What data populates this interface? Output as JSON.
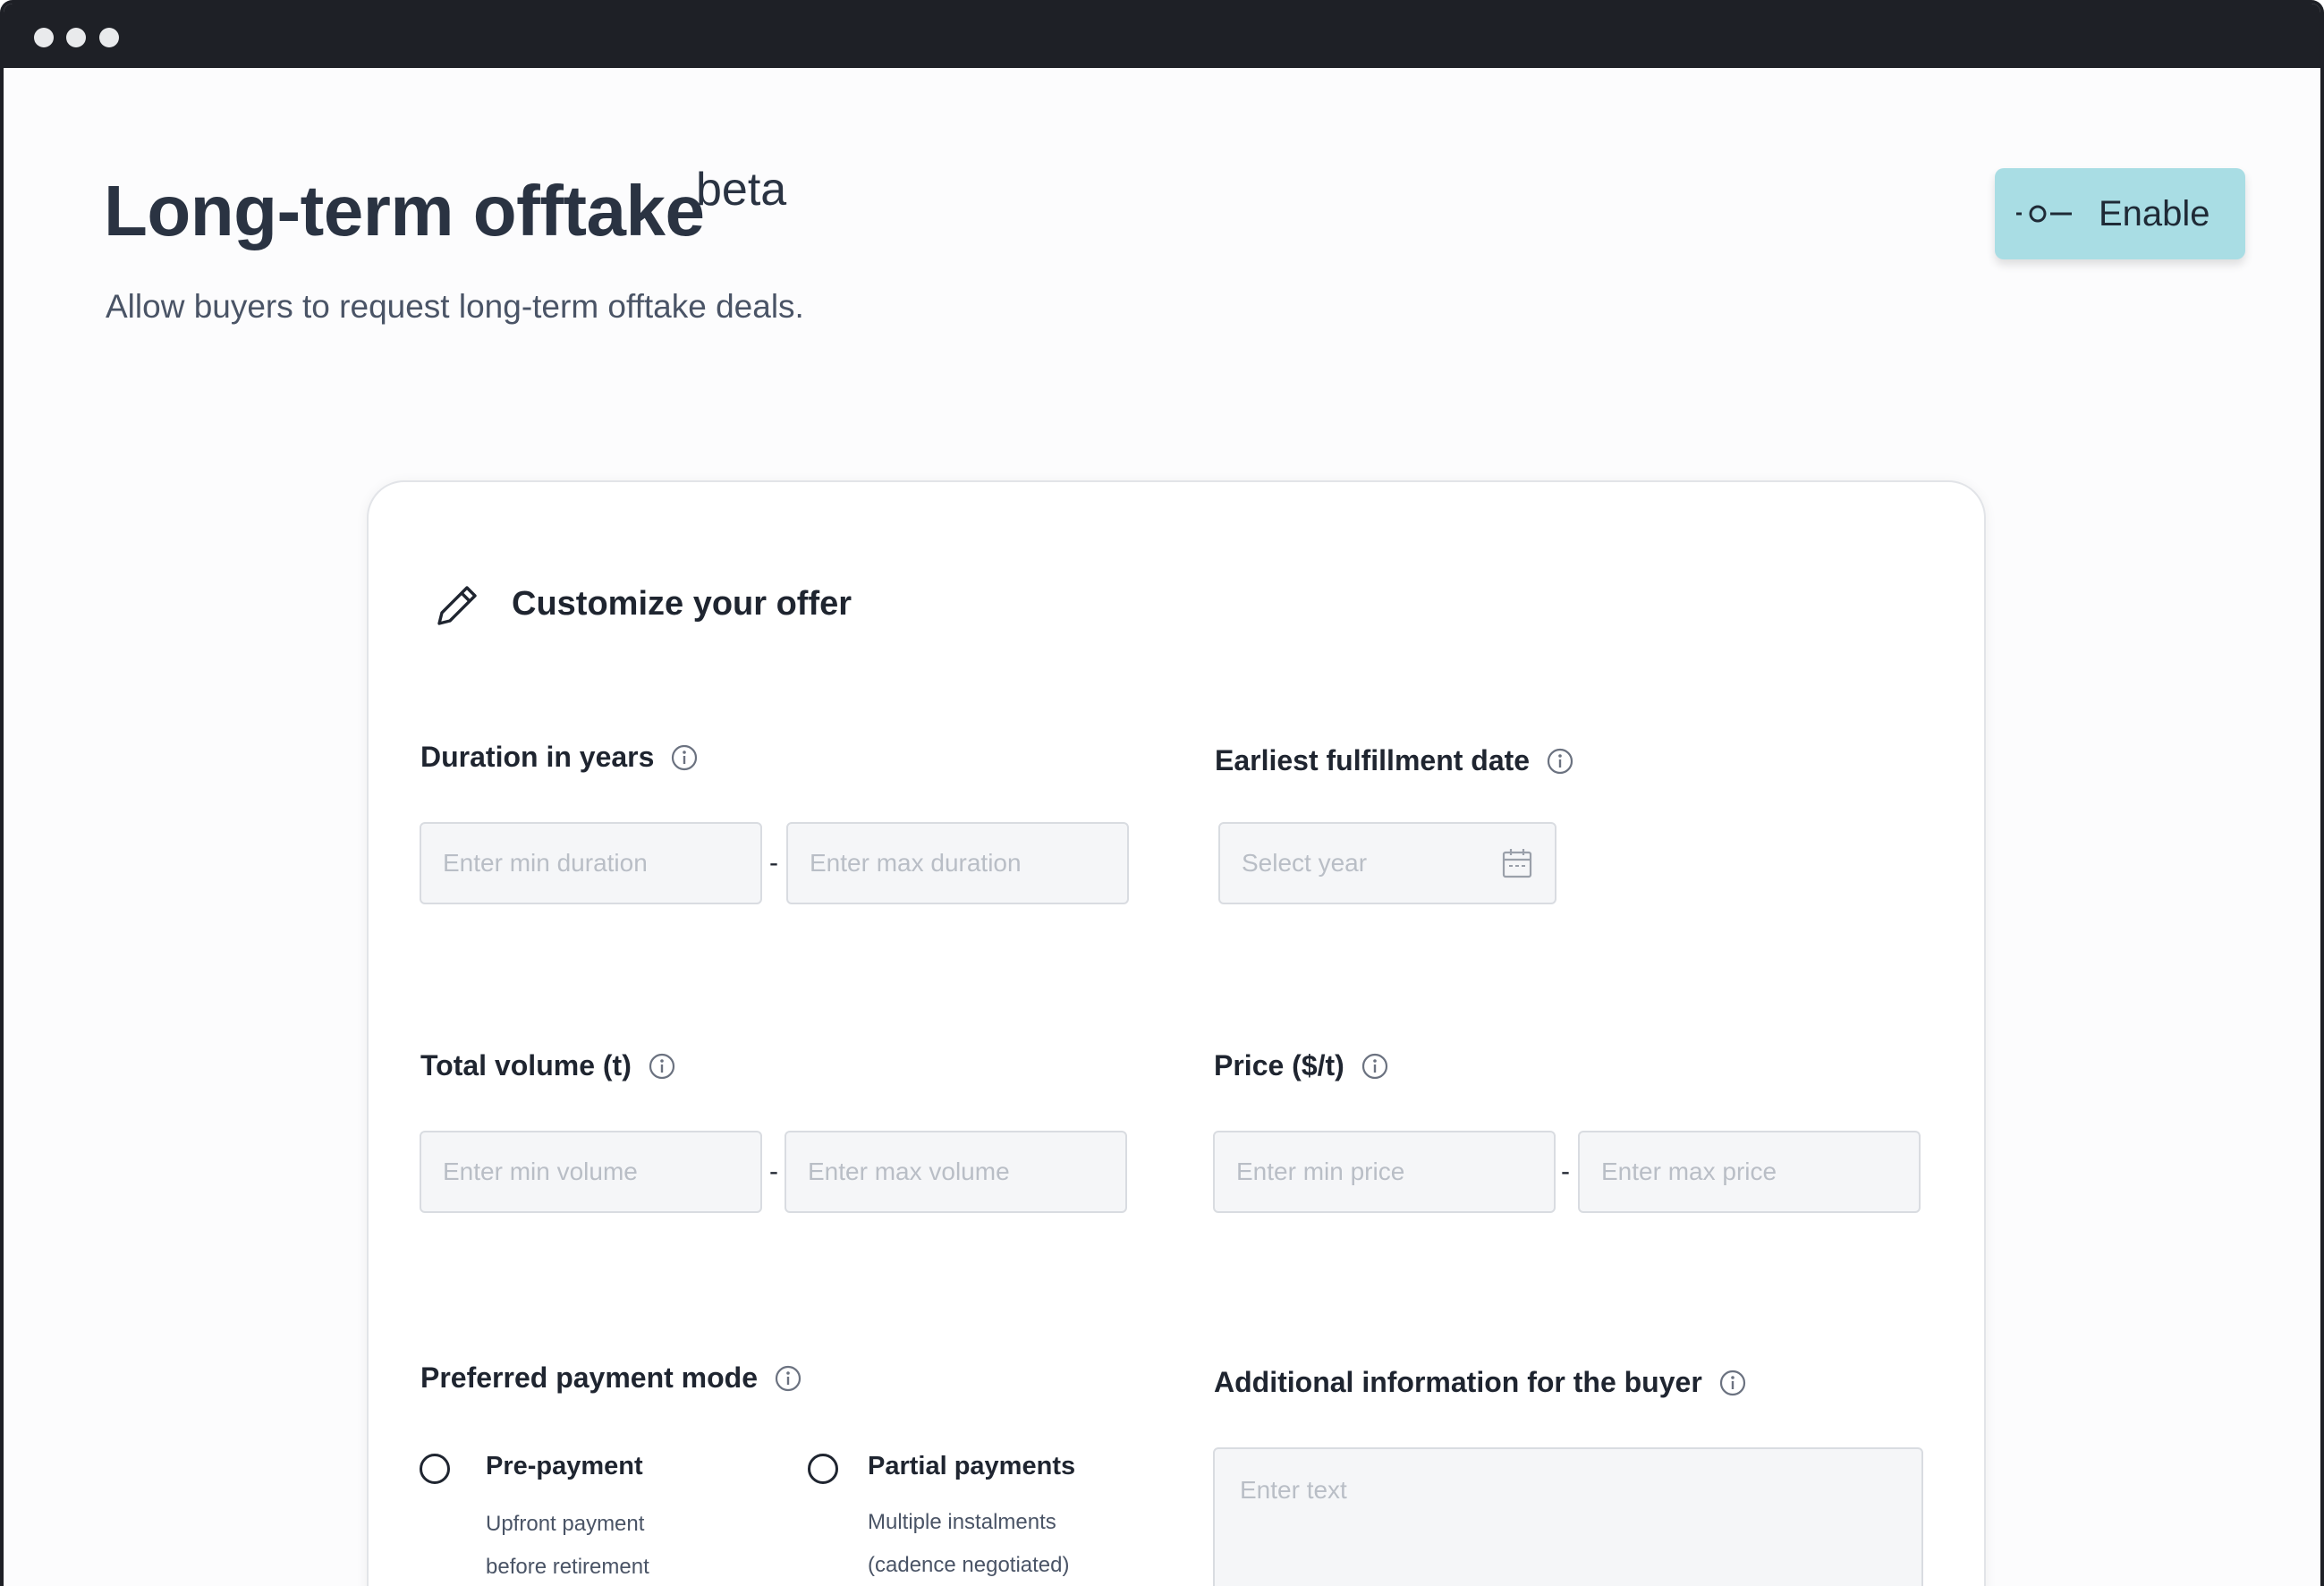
{
  "header": {
    "title": "Long-term offtake",
    "badge": "beta",
    "subtitle": "Allow buyers to request long-term offtake deals.",
    "enable_label": "Enable"
  },
  "card": {
    "title": "Customize your offer",
    "duration": {
      "label": "Duration in years",
      "min_placeholder": "Enter min duration",
      "max_placeholder": "Enter max duration",
      "separator": "-"
    },
    "fulfillment": {
      "label": "Earliest fulfillment date",
      "placeholder": "Select year"
    },
    "volume": {
      "label": "Total volume (t)",
      "min_placeholder": "Enter min volume",
      "max_placeholder": "Enter max volume",
      "separator": "-"
    },
    "price": {
      "label": "Price ($/t)",
      "min_placeholder": "Enter min price",
      "max_placeholder": "Enter max price",
      "separator": "-"
    },
    "payment": {
      "label": "Preferred payment mode",
      "options": [
        {
          "label": "Pre-payment",
          "desc_line1": "Upfront payment",
          "desc_line2": "before retirement"
        },
        {
          "label": "Partial payments",
          "desc_line1": "Multiple instalments",
          "desc_line2": "(cadence negotiated)"
        }
      ]
    },
    "additional": {
      "label": "Additional information for the buyer",
      "placeholder": "Enter text"
    }
  },
  "colors": {
    "accent": "#a9dde4",
    "title_text": "#2a3342",
    "input_bg": "#f5f6f8",
    "input_border": "#d9dce1",
    "placeholder": "#b9bec6",
    "titlebar": "#1e2026"
  },
  "icons": {
    "enable": "toggle-switch-icon",
    "card": "pencil-icon",
    "info": "info-icon",
    "calendar": "calendar-icon"
  }
}
